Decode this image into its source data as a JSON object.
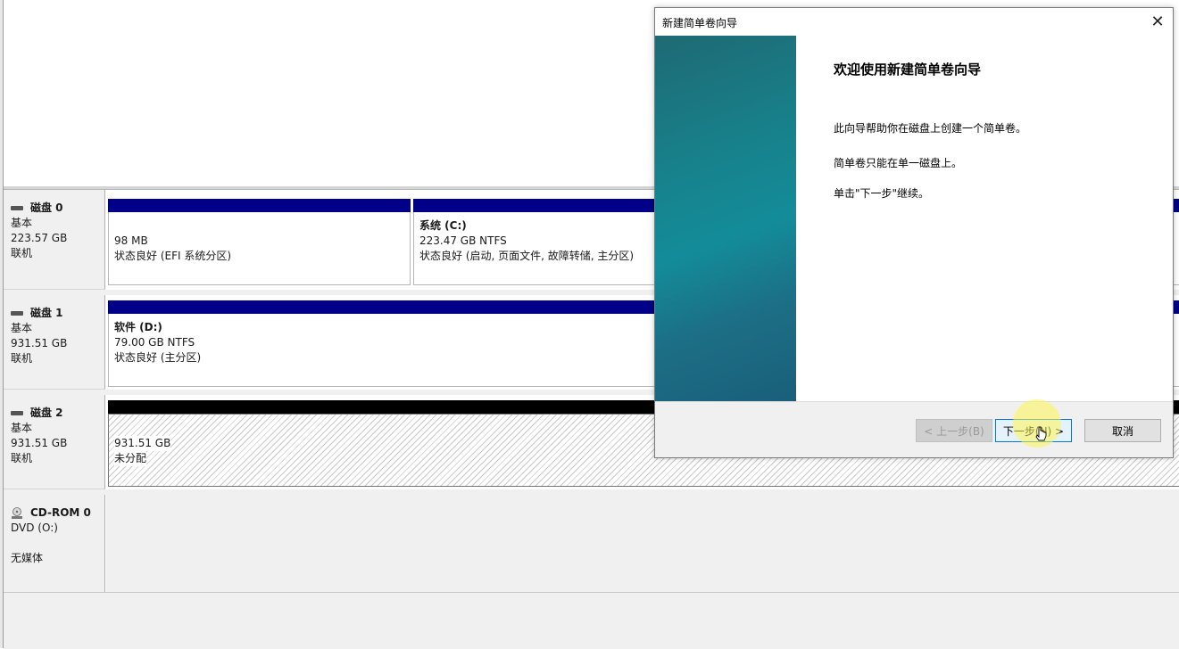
{
  "disks": [
    {
      "name": "磁盘 0",
      "type": "基本",
      "size": "223.57 GB",
      "status": "联机",
      "partitions": [
        {
          "title": "",
          "size": "98 MB",
          "status": "状态良好 (EFI 系统分区)"
        },
        {
          "title": "系统 (C:)",
          "size": "223.47 GB NTFS",
          "status": "状态良好 (启动, 页面文件, 故障转储, 主分区)"
        }
      ]
    },
    {
      "name": "磁盘 1",
      "type": "基本",
      "size": "931.51 GB",
      "status": "联机",
      "partitions": [
        {
          "title": "软件 (D:)",
          "size": "79.00 GB NTFS",
          "status": "状态良好 (主分区)"
        }
      ]
    },
    {
      "name": "磁盘 2",
      "type": "基本",
      "size": "931.51 GB",
      "status": "联机",
      "partitions": [
        {
          "title": "",
          "size": "931.51 GB",
          "status": "未分配"
        }
      ]
    }
  ],
  "cdrom": {
    "name": "CD-ROM 0",
    "type": "DVD (O:)",
    "status": "无媒体"
  },
  "wizard": {
    "title": "新建简单卷向导",
    "heading": "欢迎使用新建简单卷向导",
    "para1": "此向导帮助你在磁盘上创建一个简单卷。",
    "para2": "简单卷只能在单一磁盘上。",
    "para3": "单击\"下一步\"继续。",
    "back_label": "< 上一步(B)",
    "next_label": "下一步(N) >",
    "cancel_label": "取消"
  },
  "colors": {
    "partition_bar": "#000088",
    "unallocated_bar": "#000000",
    "wizard_side": "#17828c"
  }
}
